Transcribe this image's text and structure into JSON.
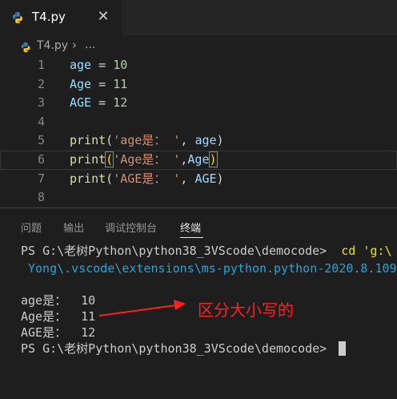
{
  "tab": {
    "title": "T4.py",
    "close_glyph": "✕",
    "icon": "python-icon"
  },
  "breadcrumb": {
    "file": "T4.py",
    "separator": "›",
    "more": "..."
  },
  "editor": {
    "lines": [
      {
        "n": "1",
        "tokens": [
          [
            "var",
            "age"
          ],
          [
            "op",
            " = "
          ],
          [
            "num",
            "10"
          ]
        ]
      },
      {
        "n": "2",
        "tokens": [
          [
            "var",
            "Age"
          ],
          [
            "op",
            " = "
          ],
          [
            "num",
            "11"
          ]
        ]
      },
      {
        "n": "3",
        "tokens": [
          [
            "var",
            "AGE"
          ],
          [
            "op",
            " = "
          ],
          [
            "num",
            "12"
          ]
        ]
      },
      {
        "n": "4",
        "tokens": []
      },
      {
        "n": "5",
        "tokens": [
          [
            "fn",
            "print"
          ],
          [
            "pn",
            "("
          ],
          [
            "str",
            "'age是： '"
          ],
          [
            "pn",
            ", "
          ],
          [
            "var",
            "age"
          ],
          [
            "pn",
            ")"
          ]
        ]
      },
      {
        "n": "6",
        "tokens": [
          [
            "fn",
            "print"
          ],
          [
            "brk",
            "("
          ],
          [
            "str",
            "'Age是： '"
          ],
          [
            "pn",
            ","
          ],
          [
            "var",
            "Age"
          ],
          [
            "brk",
            ")"
          ]
        ]
      },
      {
        "n": "7",
        "tokens": [
          [
            "fn",
            "print"
          ],
          [
            "pn",
            "("
          ],
          [
            "str",
            "'AGE是： '"
          ],
          [
            "pn",
            ", "
          ],
          [
            "var",
            "AGE"
          ],
          [
            "pn",
            ")"
          ]
        ]
      },
      {
        "n": "8",
        "tokens": []
      }
    ],
    "current_line": "6"
  },
  "panel": {
    "tabs": [
      "问题",
      "输出",
      "调试控制台",
      "终端"
    ],
    "active_tab": "终端"
  },
  "terminal": {
    "prompt1": "PS G:\\老树Python\\python38_3VScode\\democode> ",
    "cmd1": " cd 'g:\\",
    "path_line": "Yong\\.vscode\\extensions\\ms-python.python-2020.8.109",
    "out1": "age是：  10",
    "out2": "Age是：  11",
    "out3": "AGE是：  12",
    "prompt2": "PS G:\\老树Python\\python38_3VScode\\democode> "
  },
  "annotation": {
    "text": "区分大小写的",
    "color": "#ff2020"
  },
  "colors": {
    "background": "#1e1e1e",
    "tabbar": "#252526",
    "accent_red": "#ff2020"
  }
}
